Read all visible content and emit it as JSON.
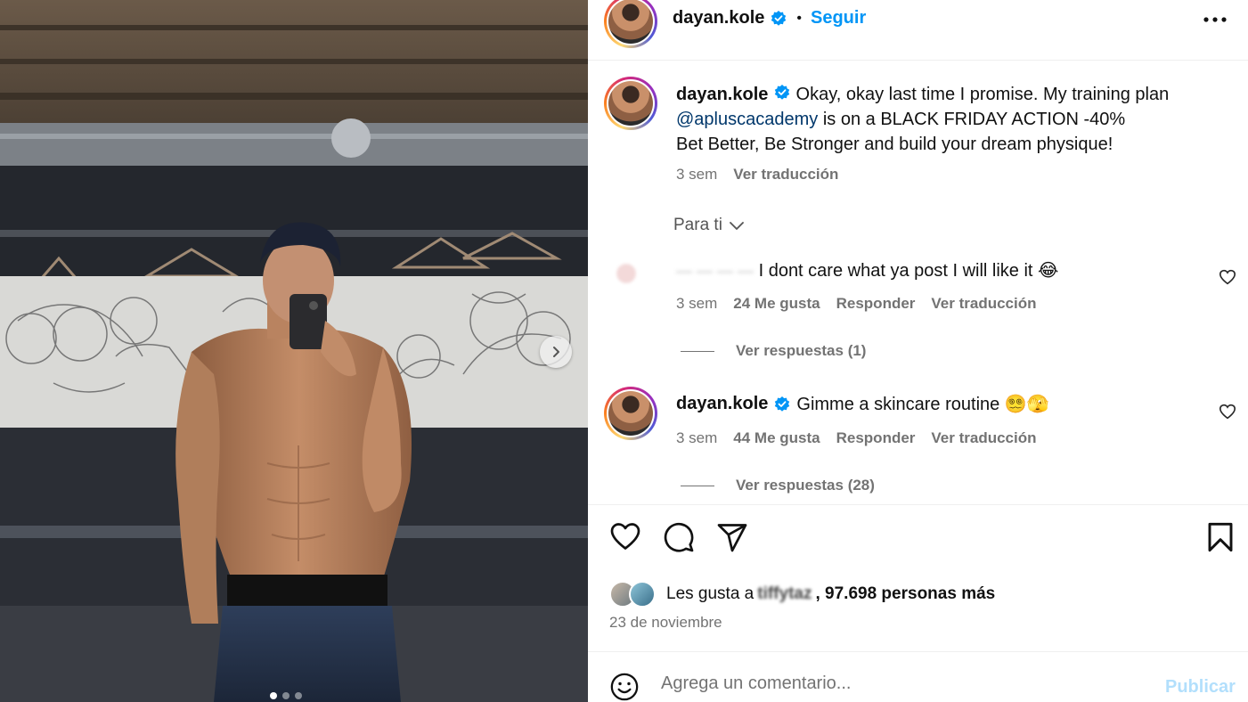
{
  "post": {
    "author": "dayan.kole",
    "separator": "•",
    "follow_label": "Seguir",
    "caption": {
      "username": "dayan.kole",
      "text_before": "Okay, okay last time I promise. My training plan",
      "mention": "@apluscacademy",
      "text_after": " is on a BLACK FRIDAY ACTION -40%",
      "line3": "Bet Better, Be Stronger and build your dream physique!",
      "time": "3 sem",
      "translate": "Ver traducción"
    },
    "filter_label": "Para ti",
    "comments": [
      {
        "username": "",
        "text": "I dont care what ya post I will like it 😂",
        "time": "3 sem",
        "likes": "24 Me gusta",
        "reply": "Responder",
        "translate": "Ver traducción",
        "view_replies": "Ver respuestas (1)"
      },
      {
        "username": "dayan.kole",
        "text": "Gimme a skincare routine 😵‍💫🫣",
        "time": "3 sem",
        "likes": "44 Me gusta",
        "reply": "Responder",
        "translate": "Ver traducción",
        "view_replies": "Ver respuestas (28)"
      }
    ],
    "likes_prefix": "Les gusta a",
    "likes_blurred_user": "tiffytaz",
    "likes_suffix": ", 97.698 personas más",
    "date": "23 de noviembre",
    "comment_placeholder": "Agrega un comentario...",
    "publish_label": "Publicar"
  },
  "carousel": {
    "total": 3,
    "active": 0
  },
  "colors": {
    "accent": "#0095f6",
    "mention": "#00376b",
    "muted": "#737373",
    "publish_disabled": "#b2dffc",
    "verified": "#0095f6"
  },
  "icons": [
    "verified-badge-icon",
    "more-options-icon",
    "chevron-down-icon",
    "heart-icon",
    "comment-icon",
    "share-icon",
    "bookmark-icon",
    "emoji-icon",
    "chevron-right-icon"
  ]
}
